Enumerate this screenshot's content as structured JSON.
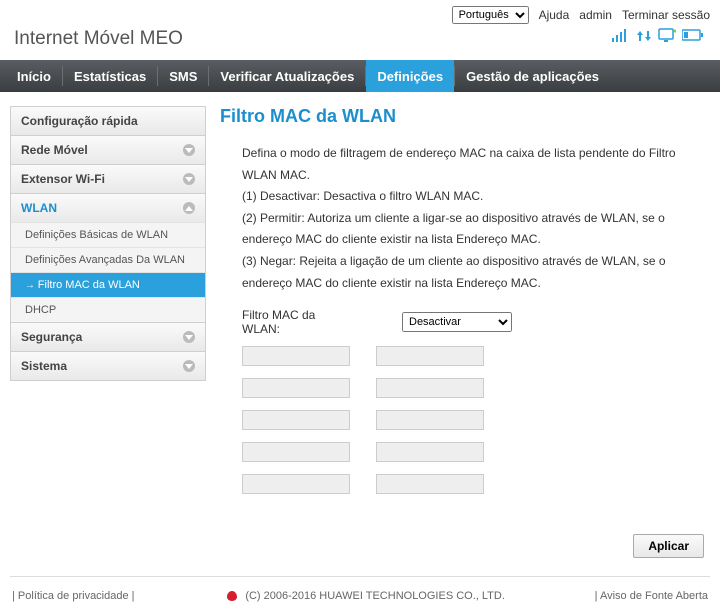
{
  "topbar": {
    "language_options": [
      "Português"
    ],
    "language_selected": "Português",
    "help": "Ajuda",
    "user": "admin",
    "logout": "Terminar sessão"
  },
  "brand": "Internet Móvel MEO",
  "status_icons": {
    "signal": "signal-4-bars",
    "updown": "up-down-arrows",
    "monitor": "monitor",
    "battery": "battery"
  },
  "nav": {
    "items": [
      {
        "label": "Início",
        "active": false
      },
      {
        "label": "Estatísticas",
        "active": false
      },
      {
        "label": "SMS",
        "active": false
      },
      {
        "label": "Verificar Atualizações",
        "active": false
      },
      {
        "label": "Definições",
        "active": true
      },
      {
        "label": "Gestão de aplicações",
        "active": false
      }
    ]
  },
  "sidebar": {
    "sections": [
      {
        "label": "Configuração rápida",
        "expanded": false,
        "children": []
      },
      {
        "label": "Rede Móvel",
        "expanded": false,
        "children": [],
        "hasChevron": true
      },
      {
        "label": "Extensor Wi-Fi",
        "expanded": false,
        "children": [],
        "hasChevron": true
      },
      {
        "label": "WLAN",
        "expanded": true,
        "hasChevron": true,
        "children": [
          {
            "label": "Definições Básicas de WLAN",
            "active": false
          },
          {
            "label": "Definições Avançadas Da WLAN",
            "active": false
          },
          {
            "label": "Filtro MAC da WLAN",
            "active": true
          },
          {
            "label": "DHCP",
            "active": false
          }
        ]
      },
      {
        "label": "Segurança",
        "expanded": false,
        "children": [],
        "hasChevron": true
      },
      {
        "label": "Sistema",
        "expanded": false,
        "children": [],
        "hasChevron": true
      }
    ]
  },
  "main": {
    "title": "Filtro MAC da WLAN",
    "desc_lines": [
      "Defina o modo de filtragem de endereço MAC na caixa de lista pendente do Filtro WLAN MAC.",
      "(1) Desactivar: Desactiva o filtro WLAN MAC.",
      "(2) Permitir: Autoriza um cliente a ligar-se ao dispositivo através de WLAN, se o endereço MAC do cliente existir na lista Endereço MAC.",
      "(3) Negar: Rejeita a ligação de um cliente ao dispositivo através de WLAN, se o endereço MAC do cliente existir na lista Endereço MAC."
    ],
    "filter_label": "Filtro MAC da WLAN:",
    "filter_options": [
      "Desactivar"
    ],
    "filter_selected": "Desactivar",
    "mac_inputs": [
      "",
      "",
      "",
      "",
      "",
      "",
      "",
      "",
      "",
      ""
    ],
    "apply": "Aplicar"
  },
  "footer": {
    "privacy": "Política de privacidade",
    "copyright": "(C) 2006-2016 HUAWEI TECHNOLOGIES CO., LTD.",
    "open_source": "Aviso de Fonte Aberta"
  }
}
